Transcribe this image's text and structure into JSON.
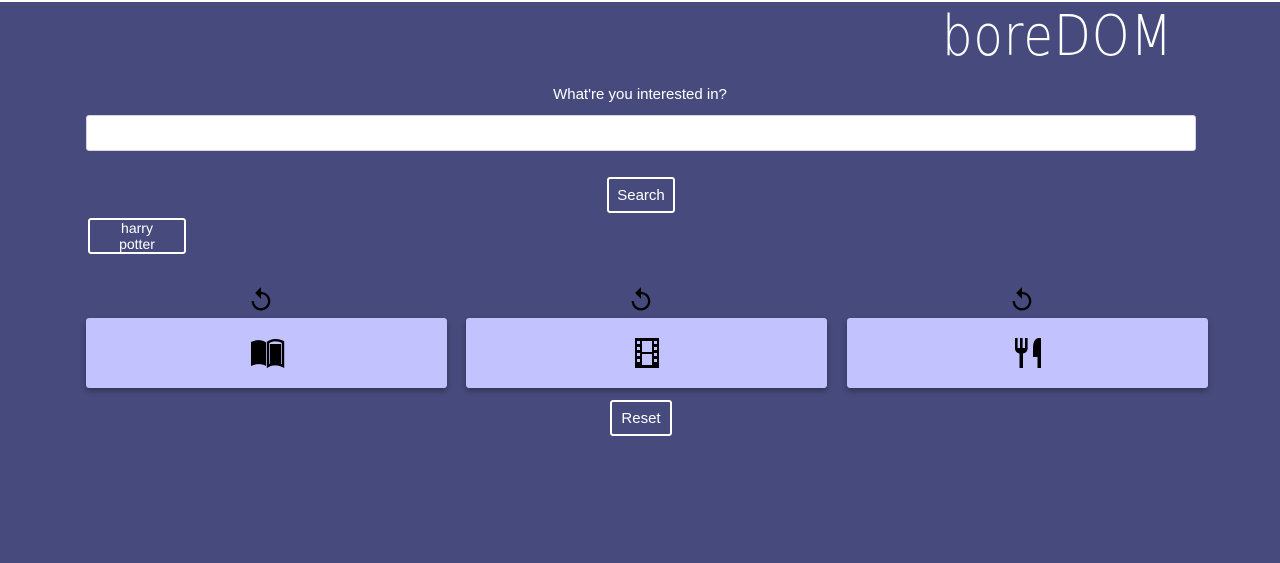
{
  "header": {
    "title": "boreDOM"
  },
  "search": {
    "prompt": "What're you interested in?",
    "value": "",
    "placeholder": "",
    "button_label": "Search"
  },
  "history": {
    "items": [
      {
        "label": "harry potter"
      }
    ]
  },
  "categories": [
    {
      "name": "books",
      "icon": "book-open-icon",
      "refresh_icon": "refresh-icon"
    },
    {
      "name": "movies",
      "icon": "film-icon",
      "refresh_icon": "refresh-icon"
    },
    {
      "name": "food",
      "icon": "fork-knife-icon",
      "refresh_icon": "refresh-icon"
    }
  ],
  "actions": {
    "reset_label": "Reset"
  },
  "colors": {
    "background": "#474a7c",
    "card": "#c2c2ff",
    "icon": "#000000",
    "text": "#ffffff"
  }
}
